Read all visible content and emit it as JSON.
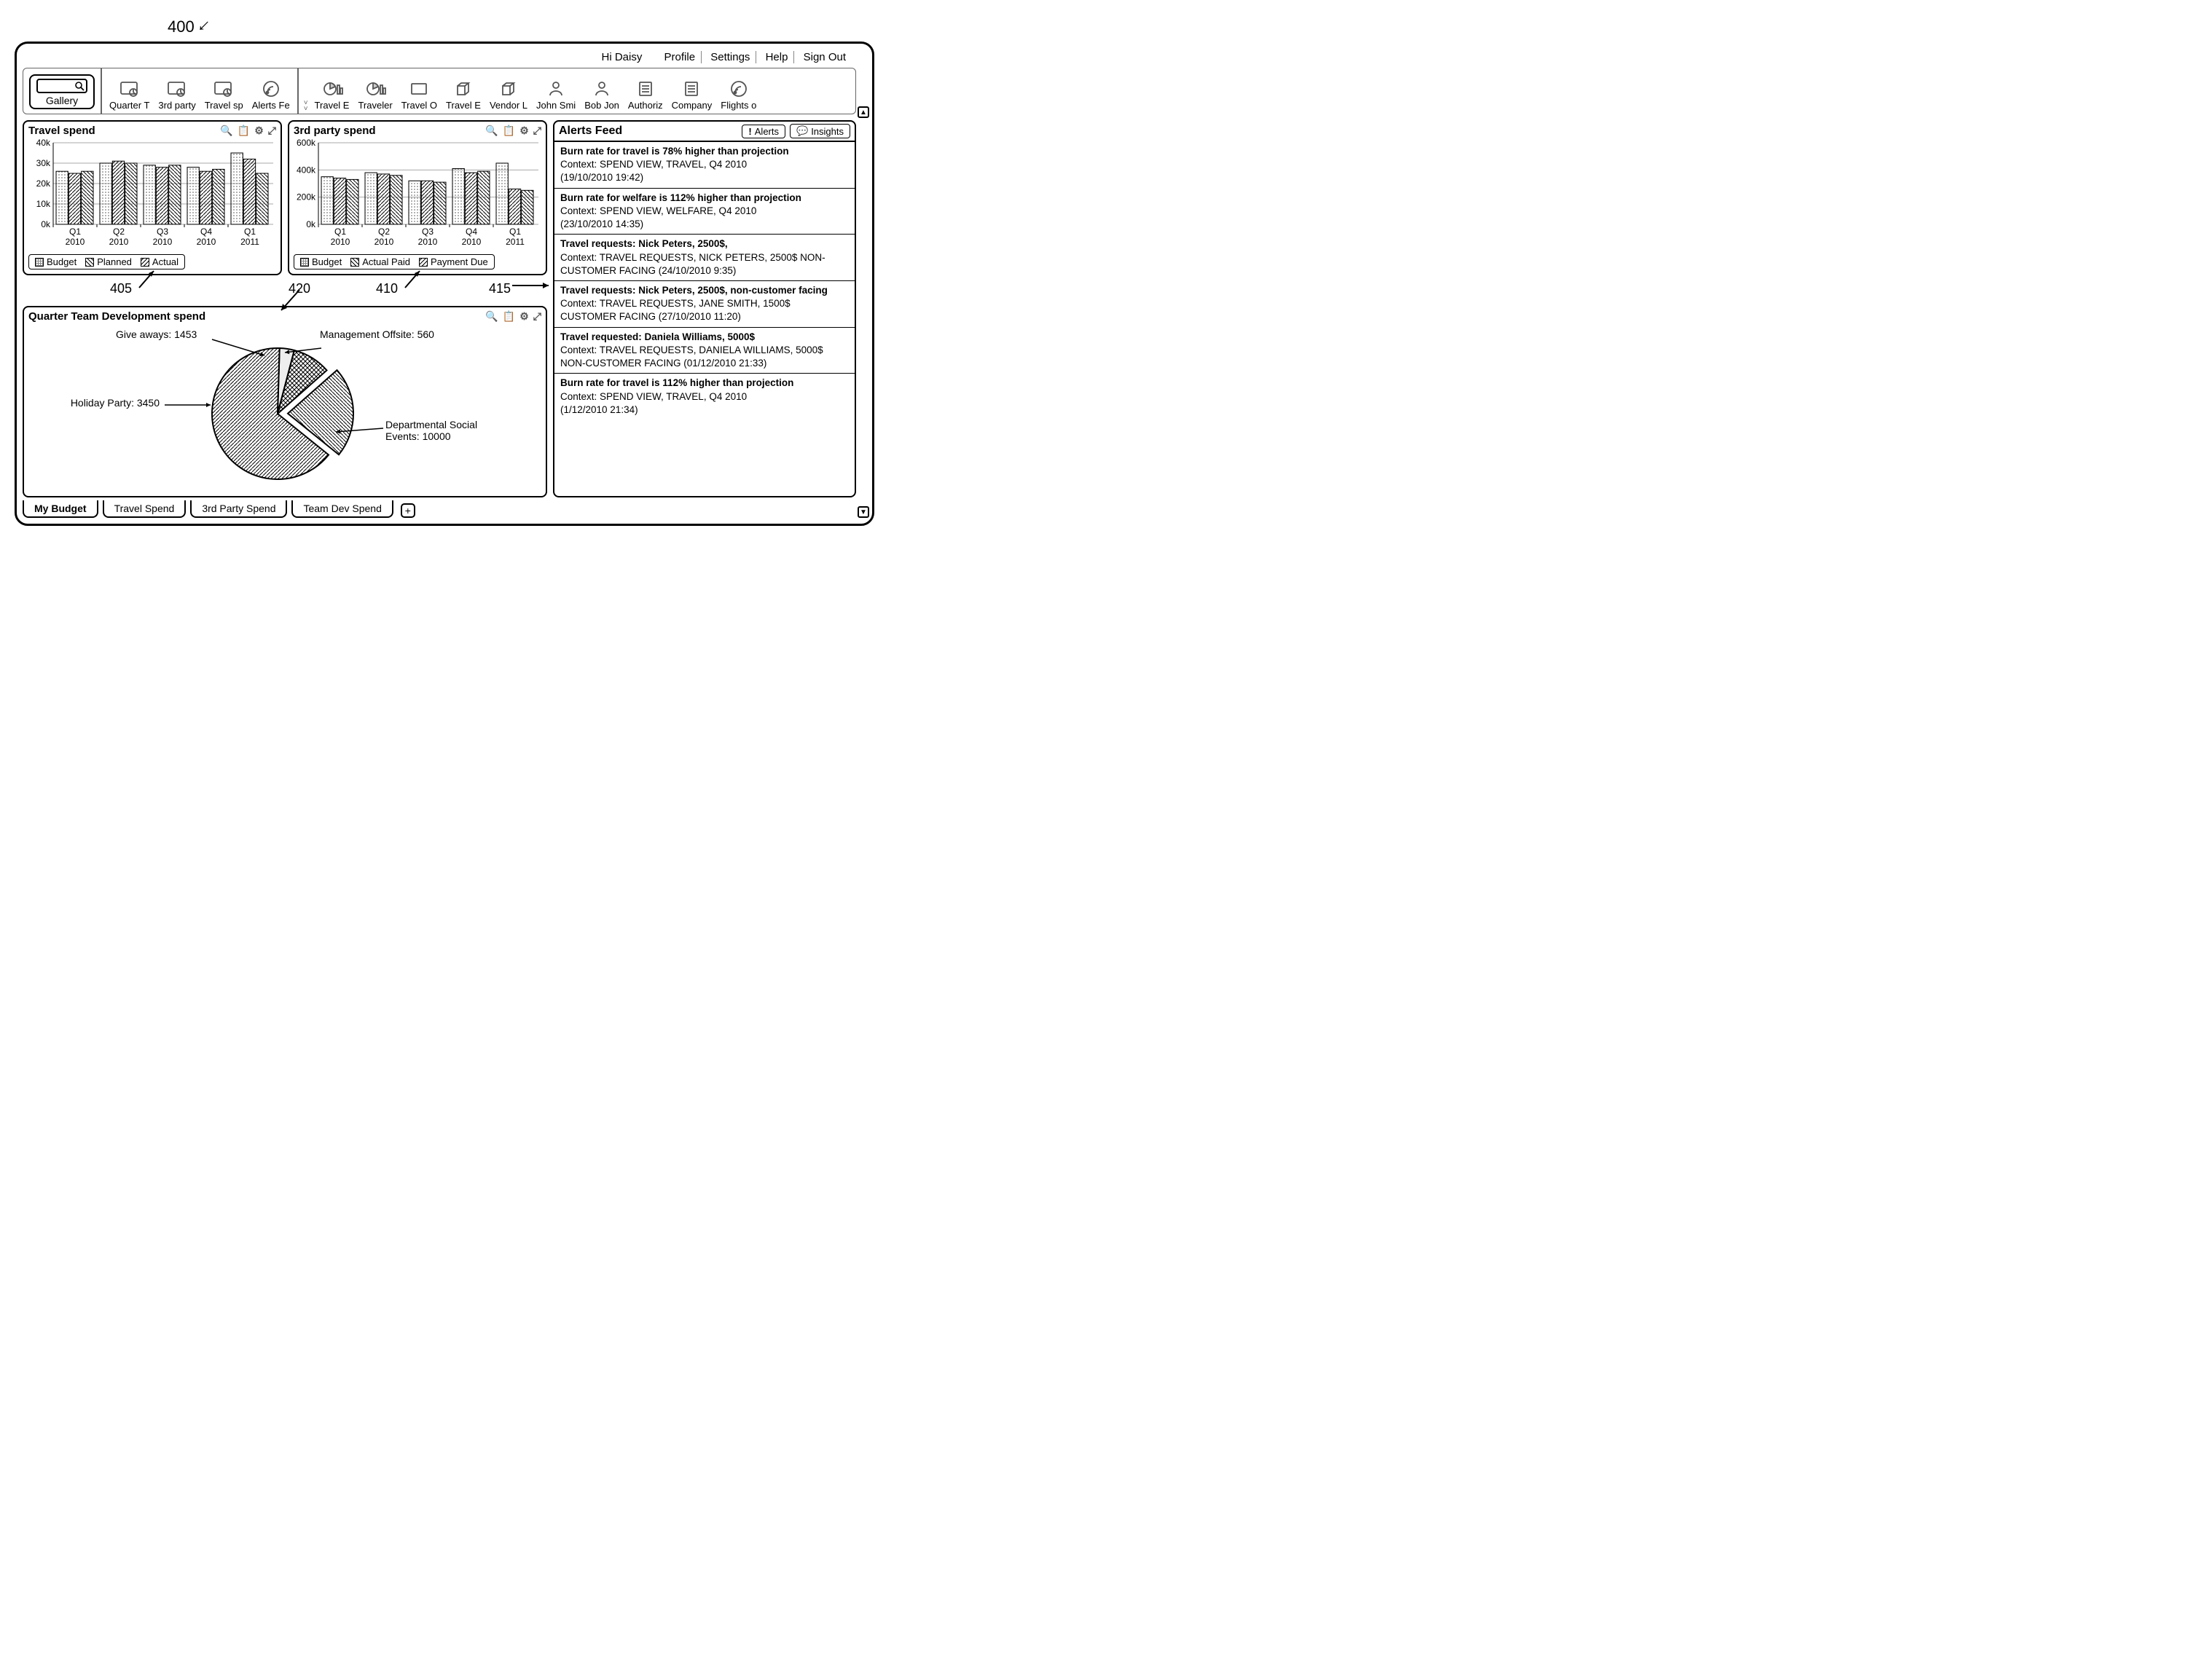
{
  "figure_number": "400",
  "callouts": {
    "travel_spend": "405",
    "third_party": "410",
    "alerts": "415",
    "dev_spend": "420"
  },
  "user_greeting": "Hi Daisy",
  "top_links": [
    "Profile",
    "Settings",
    "Help",
    "Sign Out"
  ],
  "toolbar": {
    "gallery": "Gallery",
    "group1": [
      "Quarter T",
      "3rd party",
      "Travel sp",
      "Alerts Fe"
    ],
    "group2": [
      "Travel E",
      "Traveler",
      "Travel O",
      "Travel E",
      "Vendor L",
      "John Smi",
      "Bob Jon",
      "Authoriz",
      "Company",
      "Flights o"
    ]
  },
  "panels": {
    "travel": {
      "title": "Travel spend",
      "legend": [
        "Budget",
        "Planned",
        "Actual"
      ]
    },
    "third": {
      "title": "3rd party spend",
      "legend": [
        "Budget",
        "Actual Paid",
        "Payment Due"
      ]
    },
    "dev": {
      "title": "Quarter Team Development spend"
    }
  },
  "alerts": {
    "title": "Alerts Feed",
    "tab1": "Alerts",
    "tab2": "Insights",
    "items": [
      {
        "t": "Burn rate for travel is 78% higher than projection",
        "c": "Context: SPEND VIEW, TRAVEL, Q4 2010",
        "d": "(19/10/2010 19:42)"
      },
      {
        "t": "Burn rate for welfare is 112% higher than projection",
        "c": "Context: SPEND VIEW, WELFARE, Q4 2010",
        "d": "(23/10/2010 14:35)"
      },
      {
        "t": "Travel requests: Nick Peters, 2500$,",
        "c": "Context: TRAVEL REQUESTS, NICK PETERS, 2500$ NON-CUSTOMER FACING (24/10/2010 9:35)",
        "d": ""
      },
      {
        "t": "Travel requests: Nick Peters, 2500$, non-customer facing",
        "c": "Context: TRAVEL REQUESTS, JANE SMITH, 1500$ CUSTOMER FACING (27/10/2010 11:20)",
        "d": ""
      },
      {
        "t": "Travel requested: Daniela Williams, 5000$",
        "c": "Context: TRAVEL REQUESTS, DANIELA WILLIAMS, 5000$ NON-CUSTOMER FACING (01/12/2010 21:33)",
        "d": ""
      },
      {
        "t": "Burn rate for travel is 112% higher than projection",
        "c": "Context: SPEND VIEW, TRAVEL, Q4 2010",
        "d": "(1/12/2010 21:34)"
      }
    ]
  },
  "pie_labels": {
    "giveaways": "Give aways: 1453",
    "mgmt": "Management Offsite: 560",
    "holiday": "Holiday Party: 3450",
    "dept": "Departmental Social Events: 10000"
  },
  "tabs": [
    "My Budget",
    "Travel Spend",
    "3rd Party Spend",
    "Team Dev Spend"
  ],
  "chart_data": [
    {
      "id": "travel_spend",
      "type": "bar",
      "categories": [
        "Q1 2010",
        "Q2 2010",
        "Q3 2010",
        "Q4 2010",
        "Q1 2011"
      ],
      "series": [
        {
          "name": "Budget",
          "values": [
            26,
            30,
            29,
            28,
            35
          ]
        },
        {
          "name": "Planned",
          "values": [
            25,
            31,
            28,
            26,
            32
          ]
        },
        {
          "name": "Actual",
          "values": [
            26,
            30,
            29,
            27,
            25
          ]
        }
      ],
      "ylabel": "k",
      "ylim": [
        0,
        40
      ],
      "yticks": [
        0,
        10,
        20,
        30,
        40
      ]
    },
    {
      "id": "third_party_spend",
      "type": "bar",
      "categories": [
        "Q1 2010",
        "Q2 2010",
        "Q3 2010",
        "Q4 2010",
        "Q1 2011"
      ],
      "series": [
        {
          "name": "Budget",
          "values": [
            350,
            380,
            320,
            410,
            450
          ]
        },
        {
          "name": "Actual Paid",
          "values": [
            340,
            370,
            320,
            380,
            260
          ]
        },
        {
          "name": "Payment Due",
          "values": [
            330,
            360,
            310,
            390,
            250
          ]
        }
      ],
      "ylabel": "k",
      "ylim": [
        0,
        600
      ],
      "yticks": [
        0,
        200,
        400,
        600
      ]
    },
    {
      "id": "quarter_team_dev",
      "type": "pie",
      "title": "Quarter Team Development spend",
      "slices": [
        {
          "name": "Departmental Social Events",
          "value": 10000
        },
        {
          "name": "Holiday Party",
          "value": 3450
        },
        {
          "name": "Give aways",
          "value": 1453
        },
        {
          "name": "Management Offsite",
          "value": 560
        }
      ]
    }
  ]
}
